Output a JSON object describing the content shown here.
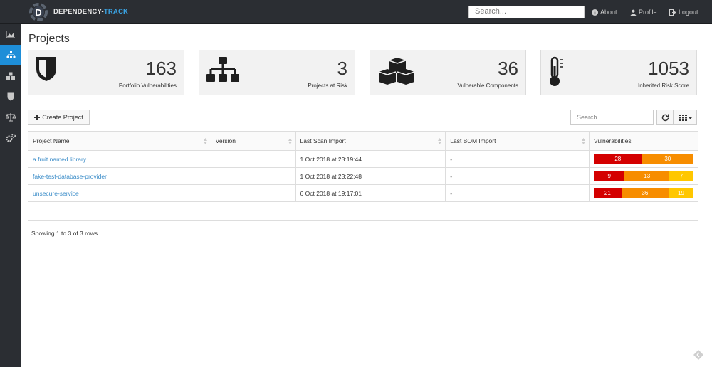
{
  "header": {
    "brand_primary": "DEPENDENCY-",
    "brand_accent": "TRACK",
    "search_placeholder": "Search...",
    "nav": [
      {
        "label": "About",
        "icon": "info-icon"
      },
      {
        "label": "Profile",
        "icon": "user-icon"
      },
      {
        "label": "Logout",
        "icon": "logout-icon"
      }
    ]
  },
  "sidebar": {
    "items": [
      {
        "icon": "dashboard-chart-icon",
        "active": false
      },
      {
        "icon": "projects-sitemap-icon",
        "active": true
      },
      {
        "icon": "components-cubes-icon",
        "active": false
      },
      {
        "icon": "vulnerabilities-shield-icon",
        "active": false
      },
      {
        "icon": "licenses-scale-icon",
        "active": false
      },
      {
        "icon": "admin-cogs-icon",
        "active": false
      }
    ]
  },
  "page": {
    "title": "Projects"
  },
  "cards": [
    {
      "value": "163",
      "label": "Portfolio Vulnerabilities",
      "icon": "shield-icon"
    },
    {
      "value": "3",
      "label": "Projects at Risk",
      "icon": "sitemap-icon"
    },
    {
      "value": "36",
      "label": "Vulnerable Components",
      "icon": "cubes-icon"
    },
    {
      "value": "1053",
      "label": "Inherited Risk Score",
      "icon": "thermometer-icon"
    }
  ],
  "toolbar": {
    "create_label": "Create Project",
    "search_placeholder": "Search"
  },
  "table": {
    "columns": [
      "Project Name",
      "Version",
      "Last Scan Import",
      "Last BOM Import",
      "Vulnerabilities"
    ],
    "rows": [
      {
        "name": "a fruit named library",
        "version": "",
        "scan": "1 Oct 2018 at 23:19:44",
        "bom": "-",
        "vulns": [
          {
            "sev": "critical",
            "count": "28",
            "value": 28
          },
          {
            "sev": "high",
            "count": "30",
            "value": 30
          }
        ]
      },
      {
        "name": "fake-test-database-provider",
        "version": "",
        "scan": "1 Oct 2018 at 23:22:48",
        "bom": "-",
        "vulns": [
          {
            "sev": "critical",
            "count": "9",
            "value": 9
          },
          {
            "sev": "high",
            "count": "13",
            "value": 13
          },
          {
            "sev": "medium",
            "count": "7",
            "value": 7
          }
        ]
      },
      {
        "name": "unsecure-service",
        "version": "",
        "scan": "6 Oct 2018 at 19:17:01",
        "bom": "-",
        "vulns": [
          {
            "sev": "critical",
            "count": "21",
            "value": 21
          },
          {
            "sev": "high",
            "count": "36",
            "value": 36
          },
          {
            "sev": "medium",
            "count": "19",
            "value": 19
          }
        ]
      }
    ]
  },
  "footer": {
    "showing": "Showing 1 to 3 of 3 rows"
  },
  "colors": {
    "critical": "#d40000",
    "high": "#f78d00",
    "medium": "#ffc700",
    "link": "#3a8cc8",
    "active": "#1e8ed8"
  }
}
